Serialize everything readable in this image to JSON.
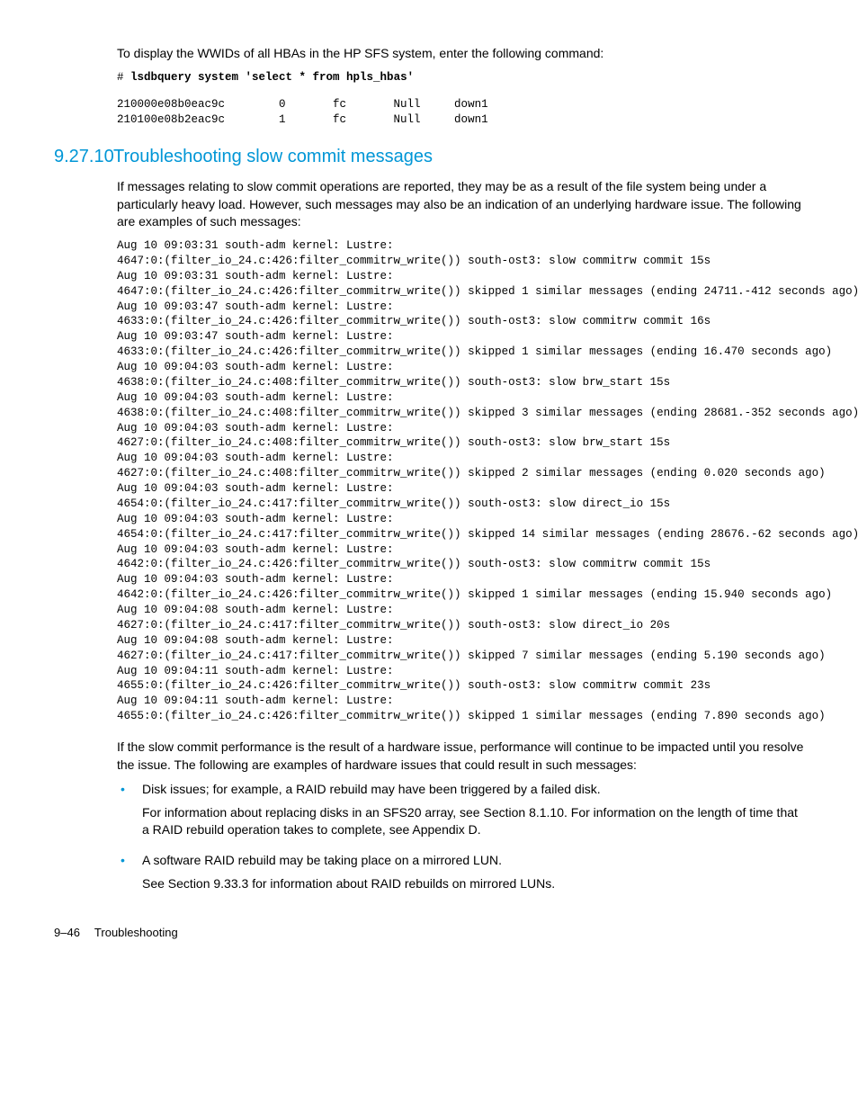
{
  "intro_para": "To display the WWIDs of all HBAs in the HP SFS system, enter the following command:",
  "cmd_prompt": "# ",
  "cmd_text": "lsdbquery system 'select * from hpls_hbas'",
  "cmd_output": "210000e08b0eac9c        0       fc       Null     down1\n210100e08b2eac9c        1       fc       Null     down1",
  "heading_num": "9.27.10",
  "heading_text": "Troubleshooting slow commit messages",
  "para1": "If messages relating to slow commit operations are reported, they may be as a result of the file system being under a particularly heavy load. However, such messages may also be an indication of an underlying hardware issue. The following are examples of such messages:",
  "log_block": "Aug 10 09:03:31 south-adm kernel: Lustre:\n4647:0:(filter_io_24.c:426:filter_commitrw_write()) south-ost3: slow commitrw commit 15s\nAug 10 09:03:31 south-adm kernel: Lustre:\n4647:0:(filter_io_24.c:426:filter_commitrw_write()) skipped 1 similar messages (ending 24711.-412 seconds ago)\nAug 10 09:03:47 south-adm kernel: Lustre:\n4633:0:(filter_io_24.c:426:filter_commitrw_write()) south-ost3: slow commitrw commit 16s\nAug 10 09:03:47 south-adm kernel: Lustre:\n4633:0:(filter_io_24.c:426:filter_commitrw_write()) skipped 1 similar messages (ending 16.470 seconds ago)\nAug 10 09:04:03 south-adm kernel: Lustre:\n4638:0:(filter_io_24.c:408:filter_commitrw_write()) south-ost3: slow brw_start 15s\nAug 10 09:04:03 south-adm kernel: Lustre:\n4638:0:(filter_io_24.c:408:filter_commitrw_write()) skipped 3 similar messages (ending 28681.-352 seconds ago)\nAug 10 09:04:03 south-adm kernel: Lustre:\n4627:0:(filter_io_24.c:408:filter_commitrw_write()) south-ost3: slow brw_start 15s\nAug 10 09:04:03 south-adm kernel: Lustre:\n4627:0:(filter_io_24.c:408:filter_commitrw_write()) skipped 2 similar messages (ending 0.020 seconds ago)\nAug 10 09:04:03 south-adm kernel: Lustre:\n4654:0:(filter_io_24.c:417:filter_commitrw_write()) south-ost3: slow direct_io 15s\nAug 10 09:04:03 south-adm kernel: Lustre:\n4654:0:(filter_io_24.c:417:filter_commitrw_write()) skipped 14 similar messages (ending 28676.-62 seconds ago)\nAug 10 09:04:03 south-adm kernel: Lustre:\n4642:0:(filter_io_24.c:426:filter_commitrw_write()) south-ost3: slow commitrw commit 15s\nAug 10 09:04:03 south-adm kernel: Lustre:\n4642:0:(filter_io_24.c:426:filter_commitrw_write()) skipped 1 similar messages (ending 15.940 seconds ago)\nAug 10 09:04:08 south-adm kernel: Lustre:\n4627:0:(filter_io_24.c:417:filter_commitrw_write()) south-ost3: slow direct_io 20s\nAug 10 09:04:08 south-adm kernel: Lustre:\n4627:0:(filter_io_24.c:417:filter_commitrw_write()) skipped 7 similar messages (ending 5.190 seconds ago)\nAug 10 09:04:11 south-adm kernel: Lustre:\n4655:0:(filter_io_24.c:426:filter_commitrw_write()) south-ost3: slow commitrw commit 23s\nAug 10 09:04:11 south-adm kernel: Lustre:\n4655:0:(filter_io_24.c:426:filter_commitrw_write()) skipped 1 similar messages (ending 7.890 seconds ago)",
  "para2": "If the slow commit performance is the result of a hardware issue, performance will continue to be impacted until you resolve the issue. The following are examples of hardware issues that could result in such messages:",
  "bullets": [
    {
      "main": "Disk issues; for example, a RAID rebuild may have been triggered by a failed disk.",
      "sub": "For information about replacing disks in an SFS20 array, see Section 8.1.10. For information on the length of time that a RAID rebuild operation takes to complete, see Appendix D."
    },
    {
      "main": "A software RAID rebuild may be taking place on a mirrored LUN.",
      "sub": "See Section 9.33.3 for information about RAID rebuilds on mirrored LUNs."
    }
  ],
  "footer_page": "9–46",
  "footer_title": "Troubleshooting"
}
